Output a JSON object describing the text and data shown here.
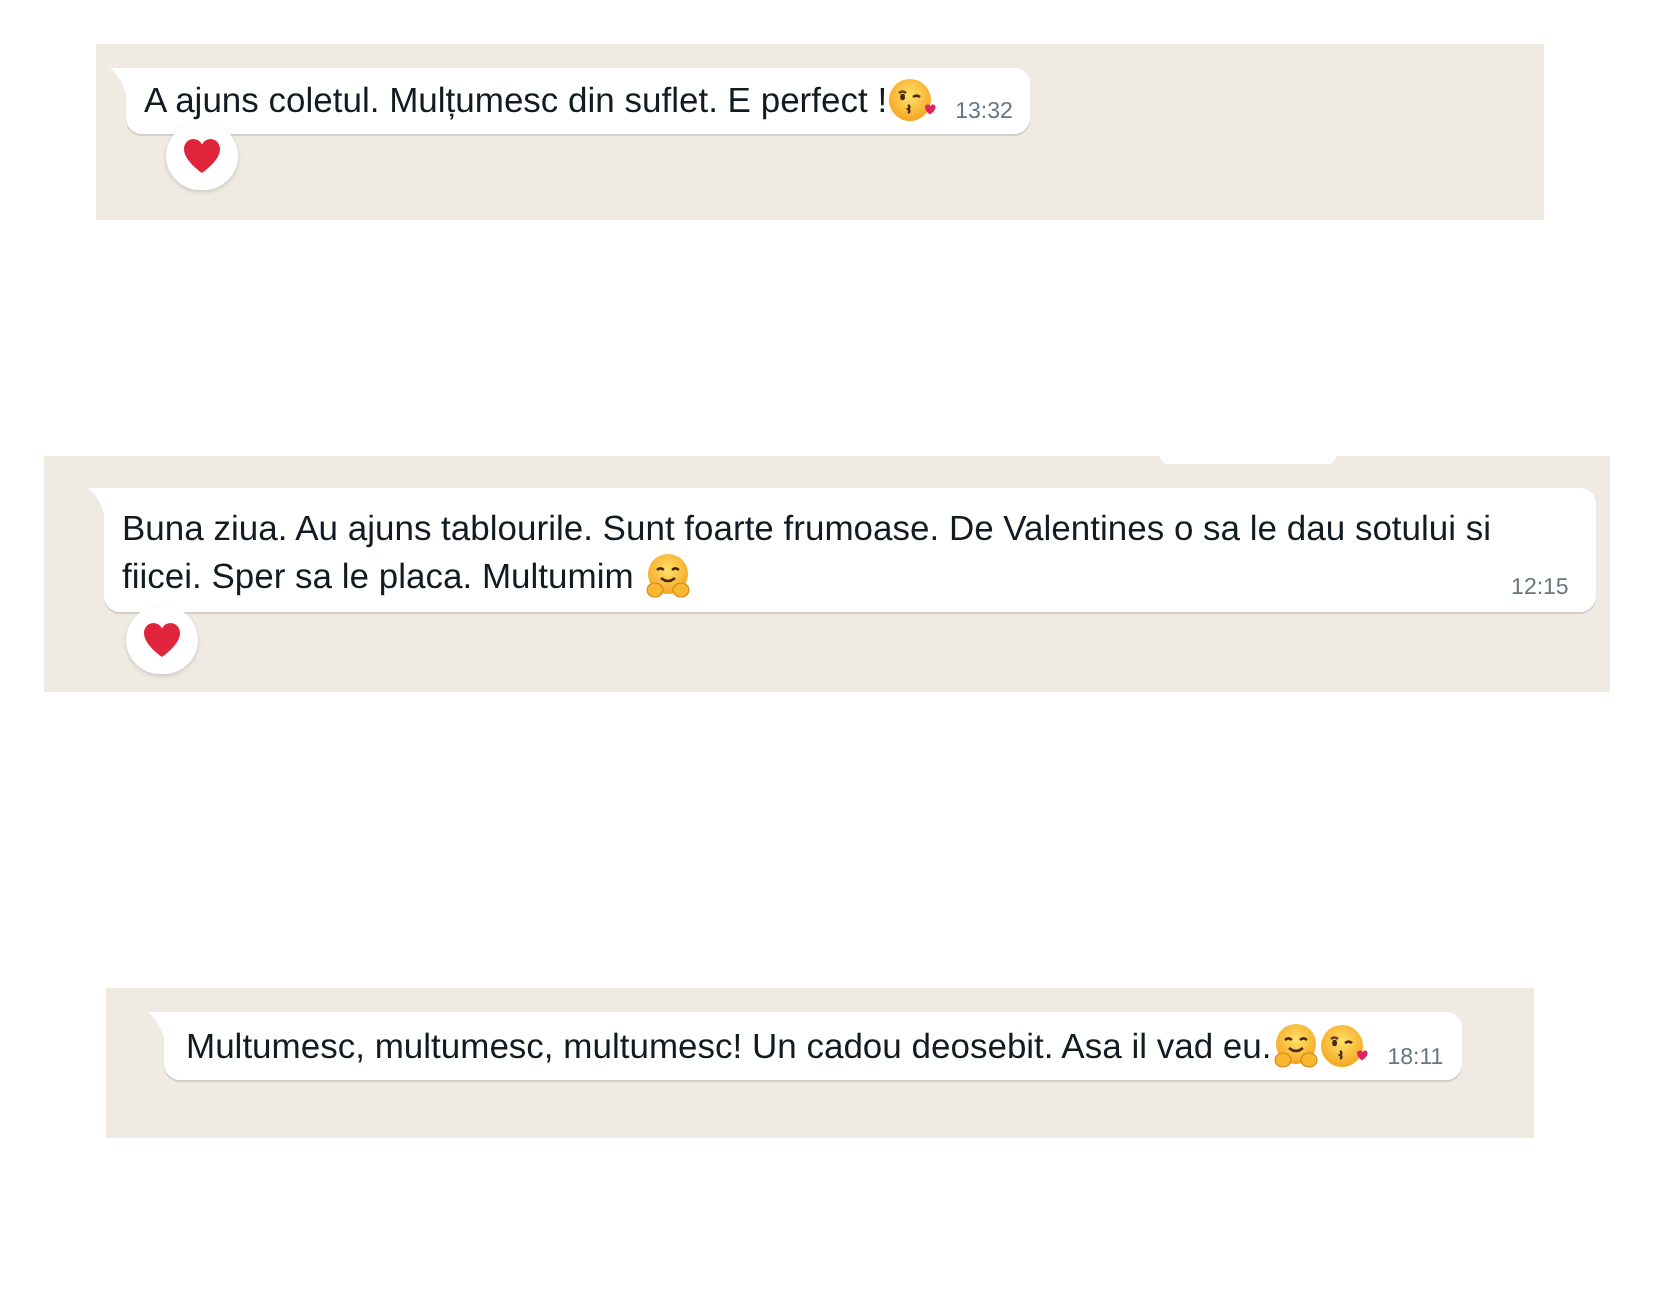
{
  "messages": [
    {
      "text": "A ajuns coletul. Mulțumesc din suflet. E perfect !",
      "emojis": [
        {
          "kind": "kiss"
        }
      ],
      "time": "13:32",
      "reaction": true,
      "previous_bubble_edge": false
    },
    {
      "text": "Buna ziua. Au ajuns tablourile. Sunt foarte frumoase. De Valentines o sa le dau sotului si fiicei. Sper sa le placa. Multumim ",
      "emojis": [
        {
          "kind": "hug"
        }
      ],
      "time": "12:15",
      "reaction": true,
      "previous_bubble_edge": true
    },
    {
      "text": "Multumesc, multumesc, multumesc! Un cadou deosebit. Asa il vad eu.",
      "emojis": [
        {
          "kind": "hug"
        },
        {
          "kind": "kiss"
        }
      ],
      "time": "18:11",
      "reaction": false,
      "previous_bubble_edge": false
    }
  ]
}
